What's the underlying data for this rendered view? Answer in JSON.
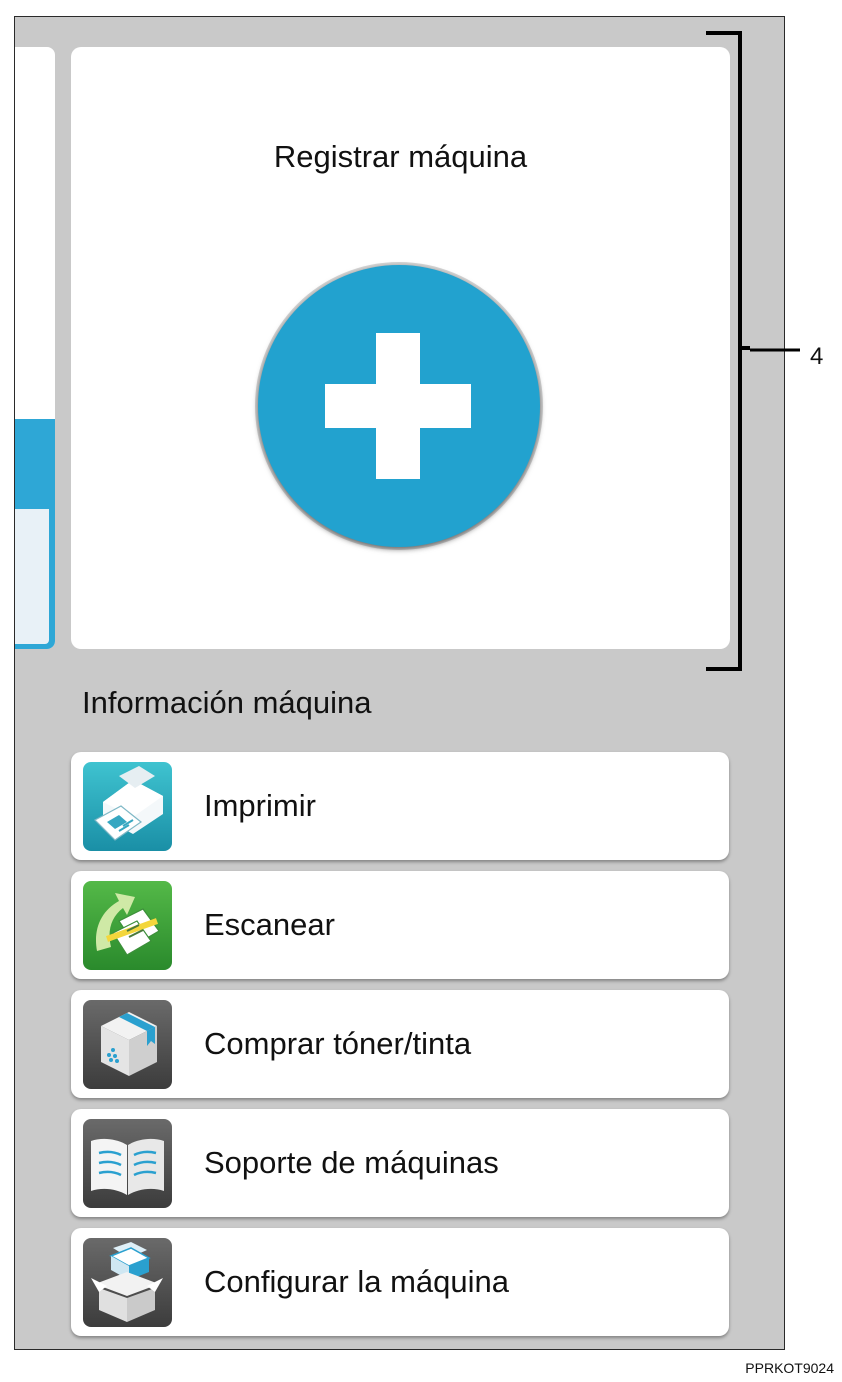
{
  "register": {
    "title": "Registrar máquina"
  },
  "info": {
    "section_title": "Información máquina"
  },
  "menu": [
    {
      "label": "Imprimir",
      "icon": "printer-icon"
    },
    {
      "label": "Escanear",
      "icon": "scanner-icon"
    },
    {
      "label": "Comprar tóner/tinta",
      "icon": "toner-box-icon"
    },
    {
      "label": "Soporte de máquinas",
      "icon": "manual-book-icon"
    },
    {
      "label": "Configurar la máquina",
      "icon": "setup-box-icon"
    }
  ],
  "annotation": {
    "callout_number": "4"
  },
  "figure_id": "PPRKOT9024",
  "colors": {
    "accent": "#22a2cf",
    "background": "#c9c9c9",
    "card": "#ffffff"
  }
}
